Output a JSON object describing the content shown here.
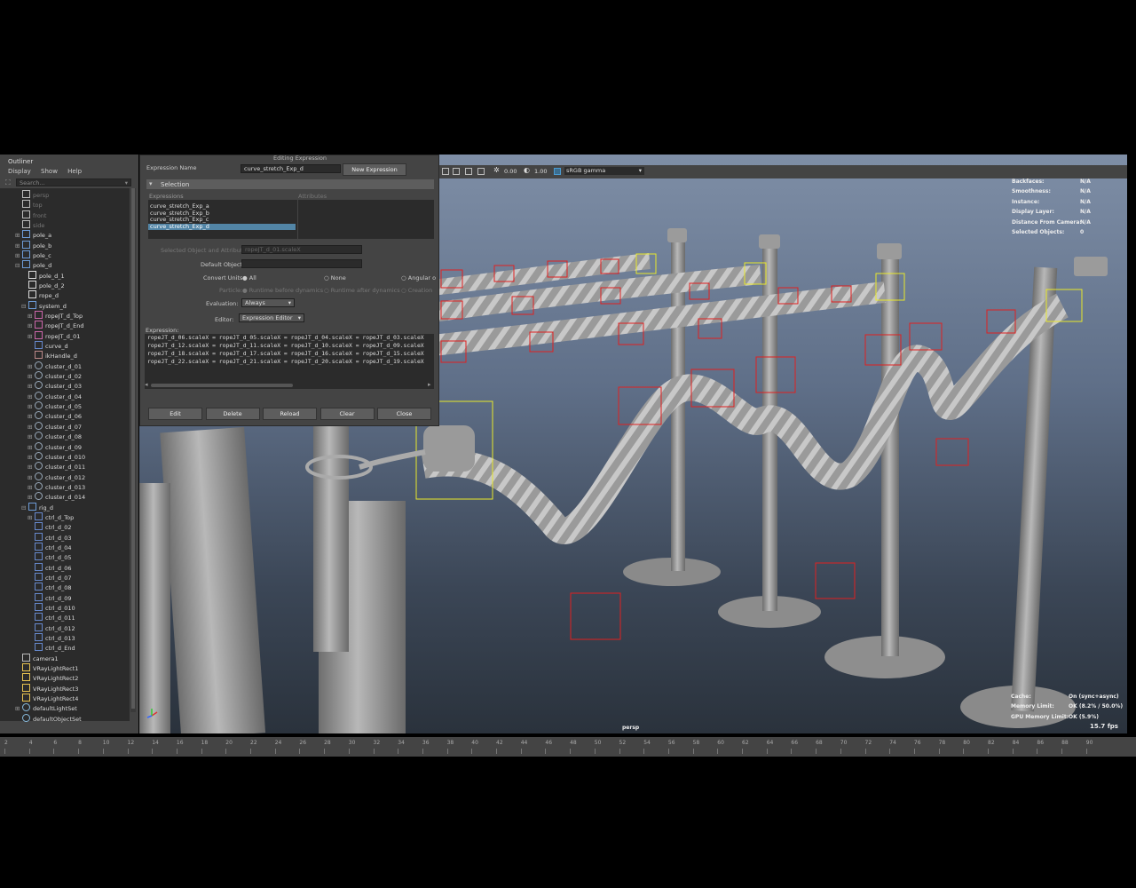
{
  "outliner": {
    "title": "Outliner",
    "menu": [
      "Display",
      "Show",
      "Help"
    ],
    "search_placeholder": "Search...",
    "items": [
      {
        "label": "persp",
        "depth": 1,
        "dim": true,
        "icon": "camera-icon"
      },
      {
        "label": "top",
        "depth": 1,
        "dim": true,
        "icon": "camera-icon"
      },
      {
        "label": "front",
        "depth": 1,
        "dim": true,
        "icon": "camera-icon"
      },
      {
        "label": "side",
        "depth": 1,
        "dim": true,
        "icon": "camera-icon"
      },
      {
        "label": "pole_a",
        "depth": 1,
        "expand": "+",
        "icon": "mesh-icon"
      },
      {
        "label": "pole_b",
        "depth": 1,
        "expand": "+",
        "icon": "mesh-icon"
      },
      {
        "label": "pole_c",
        "depth": 1,
        "expand": "+",
        "icon": "mesh-icon"
      },
      {
        "label": "pole_d",
        "depth": 1,
        "expand": "-",
        "icon": "mesh-icon"
      },
      {
        "label": "pole_d_1",
        "depth": 2,
        "icon": "transform-icon"
      },
      {
        "label": "pole_d_2",
        "depth": 2,
        "icon": "transform-icon"
      },
      {
        "label": "rope_d",
        "depth": 2,
        "icon": "transform-icon"
      },
      {
        "label": "system_d",
        "depth": 2,
        "expand": "-",
        "icon": "mesh-icon"
      },
      {
        "label": "ropeJT_d_Top",
        "depth": 3,
        "expand": "+",
        "icon": "joint-icon"
      },
      {
        "label": "ropeJT_d_End",
        "depth": 3,
        "expand": "+",
        "icon": "joint-icon"
      },
      {
        "label": "ropeJT_d_01",
        "depth": 3,
        "expand": "+",
        "icon": "joint-icon"
      },
      {
        "label": "curve_d",
        "depth": 3,
        "icon": "curve-icon"
      },
      {
        "label": "ikHandle_d",
        "depth": 3,
        "icon": "ik-icon"
      },
      {
        "label": "cluster_d_01",
        "depth": 3,
        "expand": "+",
        "icon": "cluster-icon"
      },
      {
        "label": "cluster_d_02",
        "depth": 3,
        "expand": "+",
        "icon": "cluster-icon"
      },
      {
        "label": "cluster_d_03",
        "depth": 3,
        "expand": "+",
        "icon": "cluster-icon"
      },
      {
        "label": "cluster_d_04",
        "depth": 3,
        "expand": "+",
        "icon": "cluster-icon"
      },
      {
        "label": "cluster_d_05",
        "depth": 3,
        "expand": "+",
        "icon": "cluster-icon"
      },
      {
        "label": "cluster_d_06",
        "depth": 3,
        "expand": "+",
        "icon": "cluster-icon"
      },
      {
        "label": "cluster_d_07",
        "depth": 3,
        "expand": "+",
        "icon": "cluster-icon"
      },
      {
        "label": "cluster_d_08",
        "depth": 3,
        "expand": "+",
        "icon": "cluster-icon"
      },
      {
        "label": "cluster_d_09",
        "depth": 3,
        "expand": "+",
        "icon": "cluster-icon"
      },
      {
        "label": "cluster_d_010",
        "depth": 3,
        "expand": "+",
        "icon": "cluster-icon"
      },
      {
        "label": "cluster_d_011",
        "depth": 3,
        "expand": "+",
        "icon": "cluster-icon"
      },
      {
        "label": "cluster_d_012",
        "depth": 3,
        "expand": "+",
        "icon": "cluster-icon"
      },
      {
        "label": "cluster_d_013",
        "depth": 3,
        "expand": "+",
        "icon": "cluster-icon"
      },
      {
        "label": "cluster_d_014",
        "depth": 3,
        "expand": "+",
        "icon": "cluster-icon"
      },
      {
        "label": "rig_d",
        "depth": 2,
        "expand": "-",
        "icon": "mesh-icon"
      },
      {
        "label": "ctrl_d_Top",
        "depth": 3,
        "expand": "+",
        "icon": "curve-icon"
      },
      {
        "label": "ctrl_d_02",
        "depth": 3,
        "icon": "curve-icon"
      },
      {
        "label": "ctrl_d_03",
        "depth": 3,
        "icon": "curve-icon"
      },
      {
        "label": "ctrl_d_04",
        "depth": 3,
        "icon": "curve-icon"
      },
      {
        "label": "ctrl_d_05",
        "depth": 3,
        "icon": "curve-icon"
      },
      {
        "label": "ctrl_d_06",
        "depth": 3,
        "icon": "curve-icon"
      },
      {
        "label": "ctrl_d_07",
        "depth": 3,
        "icon": "curve-icon"
      },
      {
        "label": "ctrl_d_08",
        "depth": 3,
        "icon": "curve-icon"
      },
      {
        "label": "ctrl_d_09",
        "depth": 3,
        "icon": "curve-icon"
      },
      {
        "label": "ctrl_d_010",
        "depth": 3,
        "icon": "curve-icon"
      },
      {
        "label": "ctrl_d_011",
        "depth": 3,
        "icon": "curve-icon"
      },
      {
        "label": "ctrl_d_012",
        "depth": 3,
        "icon": "curve-icon"
      },
      {
        "label": "ctrl_d_013",
        "depth": 3,
        "icon": "curve-icon"
      },
      {
        "label": "ctrl_d_End",
        "depth": 3,
        "icon": "curve-icon"
      },
      {
        "label": "camera1",
        "depth": 1,
        "icon": "camera-icon"
      },
      {
        "label": "VRayLightRect1",
        "depth": 1,
        "icon": "light-icon"
      },
      {
        "label": "VRayLightRect2",
        "depth": 1,
        "icon": "light-icon"
      },
      {
        "label": "VRayLightRect3",
        "depth": 1,
        "icon": "light-icon"
      },
      {
        "label": "VRayLightRect4",
        "depth": 1,
        "icon": "light-icon"
      },
      {
        "label": "defaultLightSet",
        "depth": 1,
        "expand": "+",
        "icon": "set-icon"
      },
      {
        "label": "defaultObjectSet",
        "depth": 1,
        "icon": "set-icon"
      }
    ]
  },
  "expression_editor": {
    "window_title": "Editing Expression",
    "name_label": "Expression Name",
    "name_value": "curve_stretch_Exp_d",
    "new_button": "New Expression",
    "section": "Selection",
    "expressions_header": "Expressions",
    "attributes_header": "Attributes",
    "expressions": [
      "curve_stretch_Exp_a",
      "curve_stretch_Exp_b",
      "curve_stretch_Exp_c",
      "curve_stretch_Exp_d"
    ],
    "selected_index": 3,
    "selected_attr_label": "Selected Object and Attribute:",
    "selected_attr_value": "ropeJT_d_01.scaleX",
    "default_object_label": "Default Object:",
    "convert_units_label": "Convert Units:",
    "convert_options": [
      "All",
      "None",
      "Angular o"
    ],
    "particle_label": "Particle:",
    "particle_options": [
      "Runtime before dynamics",
      "Runtime after dynamics",
      "Creation"
    ],
    "evaluation_label": "Evaluation:",
    "evaluation_value": "Always",
    "editor_label": "Editor:",
    "editor_value": "Expression Editor",
    "expression_label": "Expression:",
    "code": [
      "ropeJT_d_06.scaleX = ropeJT_d_05.scaleX = ropeJT_d_04.scaleX = ropeJT_d_03.scaleX",
      "ropeJT_d_12.scaleX = ropeJT_d_11.scaleX = ropeJT_d_10.scaleX = ropeJT_d_09.scaleX",
      "ropeJT_d_18.scaleX = ropeJT_d_17.scaleX = ropeJT_d_16.scaleX = ropeJT_d_15.scaleX",
      "ropeJT_d_22.scaleX = ropeJT_d_21.scaleX = ropeJT_d_20.scaleX = ropeJT_d_19.scaleX"
    ],
    "buttons": [
      "Edit",
      "Delete",
      "Reload",
      "Clear",
      "Close"
    ]
  },
  "viewport": {
    "toolbar": {
      "value1": "0.00",
      "value2": "1.00",
      "colorspace": "sRGB gamma"
    },
    "hud_top": [
      [
        "Backfaces:",
        "N/A"
      ],
      [
        "Smoothness:",
        "N/A"
      ],
      [
        "Instance:",
        "N/A"
      ],
      [
        "Display Layer:",
        "N/A"
      ],
      [
        "Distance From Camera:",
        "N/A"
      ],
      [
        "Selected Objects:",
        "0"
      ]
    ],
    "hud_bottom": [
      [
        "Cache:",
        "On (sync+async)"
      ],
      [
        "Memory Limit:",
        "OK (8.2% / 50.0%)"
      ],
      [
        "GPU Memory Limit:",
        "OK (5.9%)"
      ]
    ],
    "camera": "persp",
    "fps": "15.7 fps"
  },
  "timeline": {
    "ticks": [
      "2",
      "4",
      "6",
      "8",
      "10",
      "12",
      "14",
      "16",
      "18",
      "20",
      "22",
      "24",
      "26",
      "28",
      "30",
      "32",
      "34",
      "36",
      "38",
      "40",
      "42",
      "44",
      "46",
      "48",
      "50",
      "52",
      "54",
      "56",
      "58",
      "60",
      "62",
      "64",
      "66",
      "68",
      "70",
      "72",
      "74",
      "76",
      "78",
      "80",
      "82",
      "84",
      "86",
      "88",
      "90"
    ]
  },
  "colors": {
    "selection": "#5285a6",
    "locator": "#e02020",
    "handle": "#e8e82a"
  }
}
